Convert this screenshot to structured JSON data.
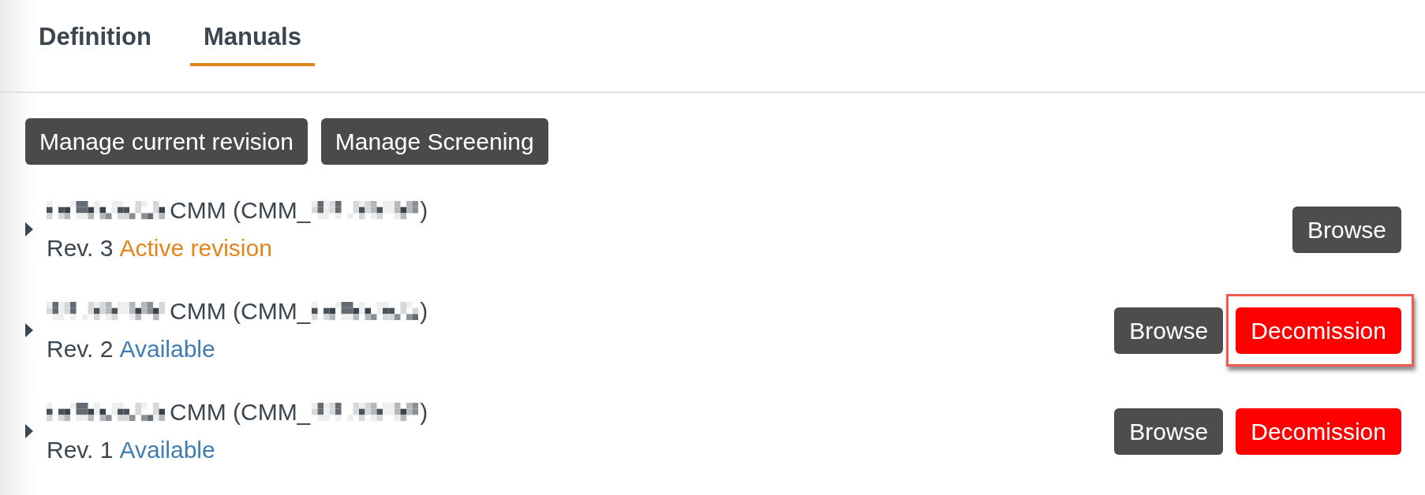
{
  "tabs": [
    {
      "label": "Definition",
      "selected": false
    },
    {
      "label": "Manuals",
      "selected": true
    }
  ],
  "toolbar": [
    {
      "label": "Manage current revision"
    },
    {
      "label": "Manage Screening"
    }
  ],
  "manuals": [
    {
      "expanded": false,
      "title_segments": [
        {
          "kind": "redacted"
        },
        {
          "kind": "text",
          "text": "CMM (CMM_"
        },
        {
          "kind": "redacted"
        },
        {
          "kind": "text",
          "text": ")"
        }
      ],
      "revision": "Rev. 3",
      "status": {
        "text": "Active revision",
        "color": "#e0861a"
      },
      "actions": [
        {
          "kind": "browse",
          "label": "Browse",
          "highlighted": false
        }
      ]
    },
    {
      "expanded": false,
      "title_segments": [
        {
          "kind": "redacted"
        },
        {
          "kind": "text",
          "text": "CMM (CMM_"
        },
        {
          "kind": "redacted"
        },
        {
          "kind": "text",
          "text": ")"
        }
      ],
      "revision": "Rev. 2",
      "status": {
        "text": "Available",
        "color": "#3e7cb1"
      },
      "actions": [
        {
          "kind": "browse",
          "label": "Browse",
          "highlighted": false
        },
        {
          "kind": "decommission",
          "label": "Decomission",
          "highlighted": true
        }
      ]
    },
    {
      "expanded": false,
      "title_segments": [
        {
          "kind": "redacted"
        },
        {
          "kind": "text",
          "text": "CMM (CMM_"
        },
        {
          "kind": "redacted"
        },
        {
          "kind": "text",
          "text": ")"
        }
      ],
      "revision": "Rev. 1",
      "status": {
        "text": "Available",
        "color": "#3e7cb1"
      },
      "actions": [
        {
          "kind": "browse",
          "label": "Browse",
          "highlighted": false
        },
        {
          "kind": "decommission",
          "label": "Decomission",
          "highlighted": false
        }
      ]
    }
  ]
}
